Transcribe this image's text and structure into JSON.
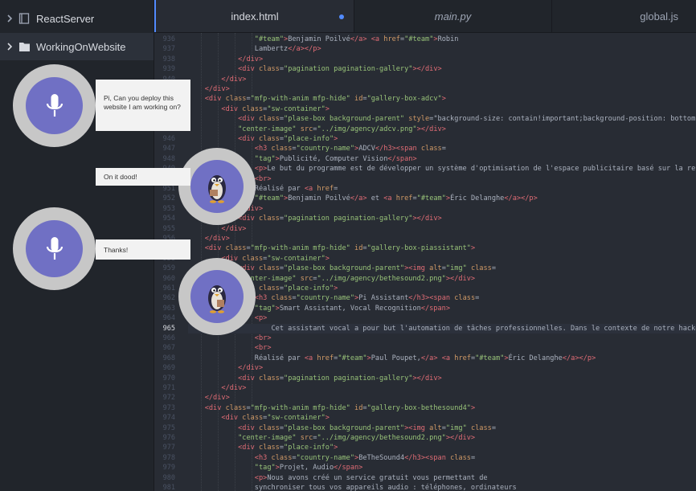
{
  "sidebar": {
    "root_label": "ReactServer",
    "folder_label": "WorkingOnWebsite"
  },
  "tabs": [
    {
      "label": "index.html",
      "modified": true
    },
    {
      "label": "main.py"
    },
    {
      "label": "global.js"
    }
  ],
  "editor": {
    "current_line": "965",
    "lines": [
      {
        "n": "936",
        "t": "                \"#team\">Benjamin Poilvé</a> <a href=\"#team\">Robin"
      },
      {
        "n": "937",
        "t": "                Lambertz</a></p>"
      },
      {
        "n": "938",
        "t": "            </div>"
      },
      {
        "n": "939",
        "t": "            <div class=\"pagination pagination-gallery\"></div>"
      },
      {
        "n": "940",
        "t": "        </div>"
      },
      {
        "n": "941",
        "t": "    </div>"
      },
      {
        "n": "942",
        "t": "    <div class=\"mfp-with-anim mfp-hide\" id=\"gallery-box-adcv\">"
      },
      {
        "n": "943",
        "t": "        <div class=\"sw-container\">"
      },
      {
        "n": "944",
        "t": "            <div class=\"plase-box background-parent\" style=\"background-size: contain!important;background-position: bottom!"
      },
      {
        "n": "945",
        "t": "            \"center-image\" src=\"../img/agency/adcv.png\"></div>"
      },
      {
        "n": "946",
        "t": "            <div class=\"place-info\">"
      },
      {
        "n": "947",
        "t": "                <h3 class=\"country-name\">ADCV</h3><span class="
      },
      {
        "n": "948",
        "t": "                \"tag\">Publicité, Computer Vision</span>"
      },
      {
        "n": "949",
        "t": "                <p>Le but du programme est de développer un système d'optimisation de l'espace publicitaire basé sur la reco"
      },
      {
        "n": "950",
        "t": "                <br>"
      },
      {
        "n": "951",
        "t": "                Réalisé par <a href="
      },
      {
        "n": "952",
        "t": "                \"#team\">Benjamin Poilvé</a> et <a href=\"#team\">Éric Delanghe</a></p>"
      },
      {
        "n": "953",
        "t": "            </div>"
      },
      {
        "n": "954",
        "t": "            <div class=\"pagination pagination-gallery\"></div>"
      },
      {
        "n": "955",
        "t": "        </div>"
      },
      {
        "n": "956",
        "t": "    </div>"
      },
      {
        "n": "957",
        "t": "    <div class=\"mfp-with-anim mfp-hide\" id=\"gallery-box-piassistant\">"
      },
      {
        "n": "958",
        "t": "        <div class=\"sw-container\">"
      },
      {
        "n": "959",
        "t": "            <div class=\"plase-box background-parent\"><img alt=\"img\" class="
      },
      {
        "n": "960",
        "t": "            \"center-image\" src=\"../img/agency/bethesound2.png\"></div>"
      },
      {
        "n": "961",
        "t": "            <div class=\"place-info\">"
      },
      {
        "n": "962",
        "t": "                <h3 class=\"country-name\">Pi Assistant</h3><span class="
      },
      {
        "n": "963",
        "t": "                \"tag\">Smart Assistant, Vocal Recognition</span>"
      },
      {
        "n": "964",
        "t": "                <p>"
      },
      {
        "n": "965",
        "t": "                    Cet assistant vocal a pour but l'automation de tâches professionnelles. Dans le contexte de notre hackep"
      },
      {
        "n": "966",
        "t": "                <br>"
      },
      {
        "n": "967",
        "t": "                <br>"
      },
      {
        "n": "968",
        "t": "                Réalisé par <a href=\"#team\">Paul Poupet,</a> <a href=\"#team\">Éric Delanghe</a></p>"
      },
      {
        "n": "969",
        "t": "            </div>"
      },
      {
        "n": "970",
        "t": "            <div class=\"pagination pagination-gallery\"></div>"
      },
      {
        "n": "971",
        "t": "        </div>"
      },
      {
        "n": "972",
        "t": "    </div>"
      },
      {
        "n": "973",
        "t": "    <div class=\"mfp-with-anim mfp-hide\" id=\"gallery-box-bethesound4\">"
      },
      {
        "n": "974",
        "t": "        <div class=\"sw-container\">"
      },
      {
        "n": "975",
        "t": "            <div class=\"plase-box background-parent\"><img alt=\"img\" class="
      },
      {
        "n": "976",
        "t": "            \"center-image\" src=\"../img/agency/bethesound2.png\"></div>"
      },
      {
        "n": "977",
        "t": "            <div class=\"place-info\">"
      },
      {
        "n": "978",
        "t": "                <h3 class=\"country-name\">BeTheSound4</h3><span class="
      },
      {
        "n": "979",
        "t": "                \"tag\">Projet, Audio</span>"
      },
      {
        "n": "980",
        "t": "                <p>Nous avons créé un service gratuit vous permettant de"
      },
      {
        "n": "981",
        "t": "                synchroniser tous vos appareils audio : téléphones, ordinateurs"
      }
    ]
  },
  "chat": {
    "user_msg_1": "Pi, Can you deploy this website I am working on?",
    "bot_msg_1": "On it dood!",
    "user_msg_2": "Thanks!"
  },
  "colors": {
    "accent": "#528bff",
    "avatar_fill": "#7070c4",
    "avatar_ring": "#c7c7c7"
  }
}
